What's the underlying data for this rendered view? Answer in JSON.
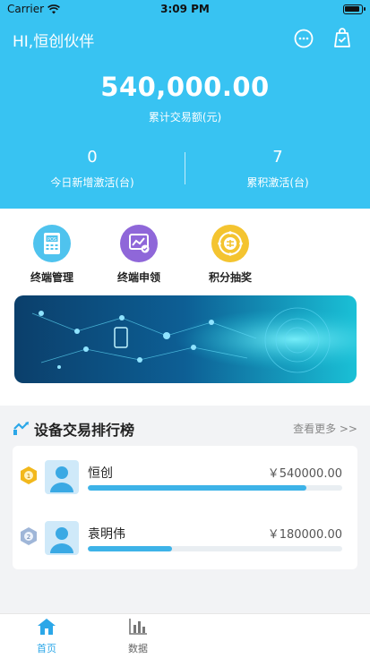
{
  "status_bar": {
    "carrier": "Carrier",
    "time": "3:09 PM"
  },
  "header": {
    "greeting": "HI,恒创伙伴",
    "icons": [
      "chat-icon",
      "shopping-bag-check-icon"
    ]
  },
  "summary": {
    "total_amount": "540,000.00",
    "total_label": "累计交易额(元)",
    "today_new_activation_value": "0",
    "today_new_activation_label": "今日新增激活(台)",
    "cumulative_activation_value": "7",
    "cumulative_activation_label": "累积激活(台)"
  },
  "menu": [
    {
      "label": "终端管理",
      "icon": "pos-terminal-icon",
      "color": "#4fc3ee"
    },
    {
      "label": "终端申领",
      "icon": "terminal-apply-icon",
      "color": "#8f67d9"
    },
    {
      "label": "积分抽奖",
      "icon": "lottery-wheel-icon",
      "color": "#f4c430"
    }
  ],
  "ranking": {
    "title": "设备交易排行榜",
    "see_more": "查看更多 >>",
    "rows": [
      {
        "rank": "1",
        "name": "恒创",
        "amount": "￥540000.00",
        "progress": 0.86
      },
      {
        "rank": "2",
        "name": "袁明伟",
        "amount": "￥180000.00",
        "progress": 0.33
      }
    ]
  },
  "tabbar": [
    {
      "label": "首页",
      "active": true
    },
    {
      "label": "数据",
      "active": false
    }
  ],
  "colors": {
    "primary": "#38c3f2",
    "accent_blue": "#3db3e8",
    "tab_active": "#2ba7e8"
  }
}
